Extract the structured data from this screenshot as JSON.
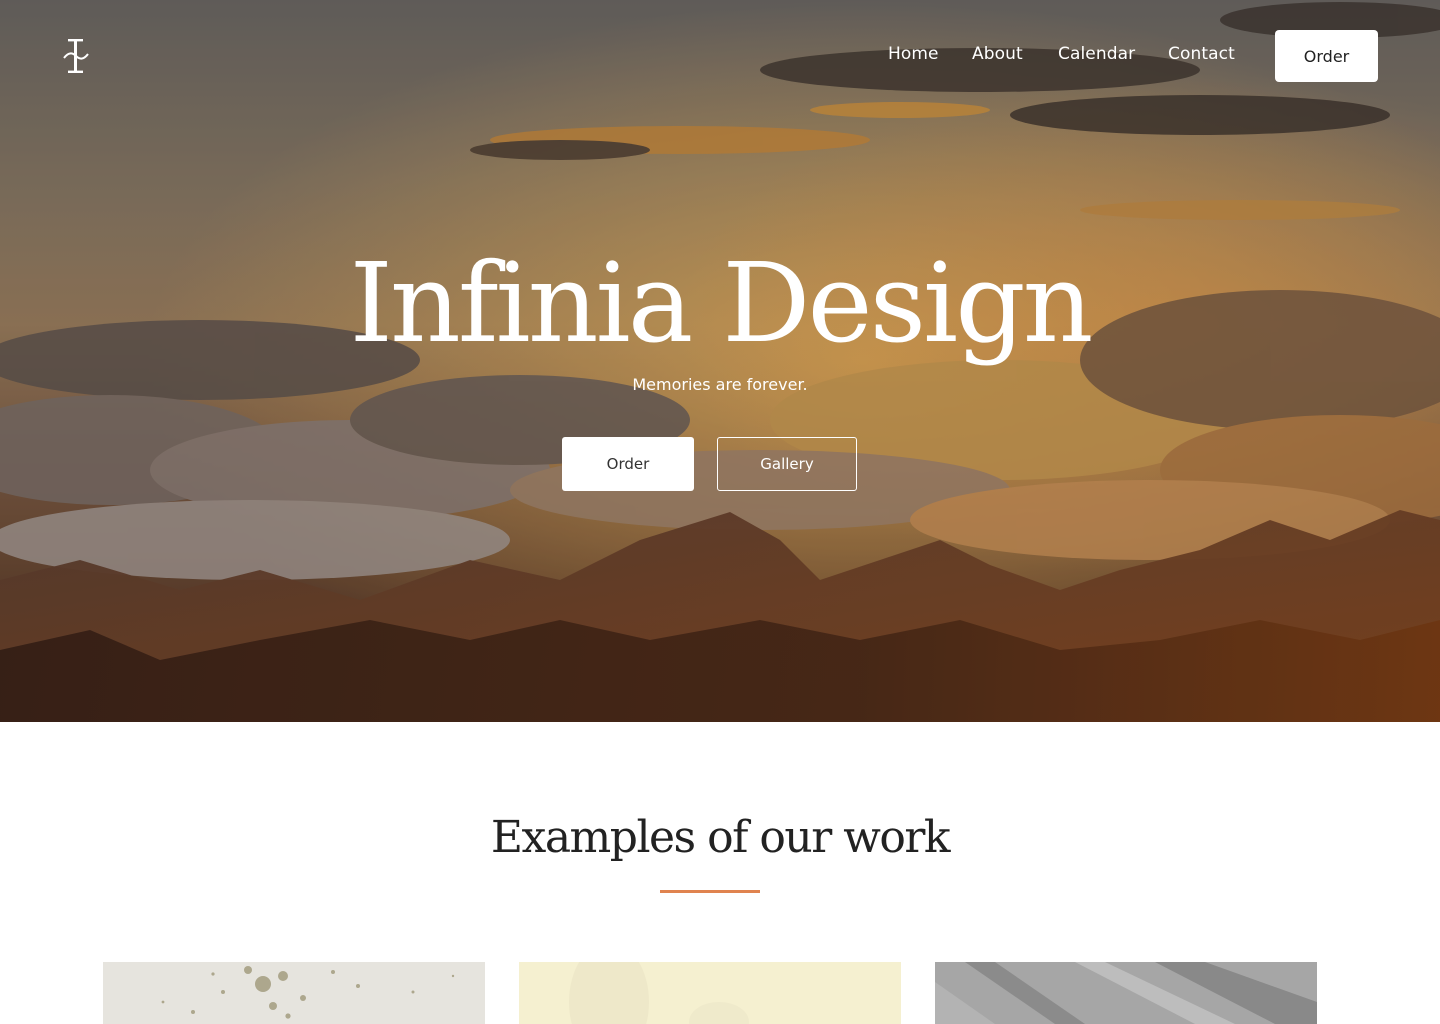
{
  "brand": {
    "logo_icon": "infinia-logo-icon"
  },
  "nav": {
    "links": [
      "Home",
      "About",
      "Calendar",
      "Contact"
    ],
    "order_label": "Order"
  },
  "hero": {
    "title": "Infinia Design",
    "subtitle": "Memories are forever.",
    "order_label": "Order",
    "gallery_label": "Gallery"
  },
  "examples": {
    "title": "Examples of our work",
    "accent_color": "#e0834f",
    "cards": [
      {
        "image": "watercolor-splatter-paper"
      },
      {
        "image": "pale-yellow-textured-paper"
      },
      {
        "image": "grey-fabric-texture"
      }
    ]
  },
  "colors": {
    "accent": "#e0834f",
    "button_bg": "#ffffff"
  }
}
